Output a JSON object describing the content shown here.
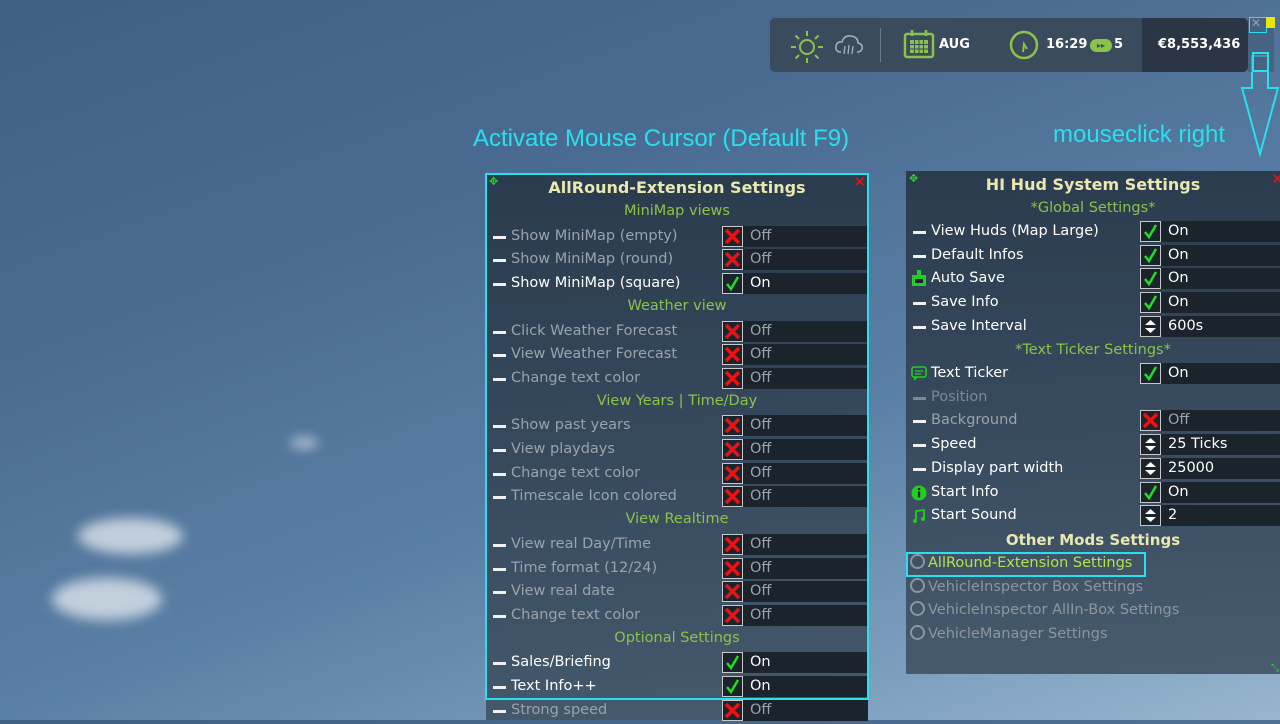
{
  "annotations": {
    "activate_cursor": "Activate Mouse Cursor (Default F9)",
    "mouseclick_right": "mouseclick right"
  },
  "hud": {
    "weather_icons": [
      "sun-icon",
      "cloud-rain-icon"
    ],
    "month": "AUG",
    "time": "16:29",
    "timescale": "5",
    "money": "€8,553,436"
  },
  "colors": {
    "accent_cyan": "#29e0ee",
    "section_green": "#8bc34a",
    "title_yellow": "#e8e8b0",
    "check_green": "#22dd22",
    "cross_red": "#ee1111"
  },
  "allround_panel": {
    "title": "AllRound-Extension Settings",
    "sections": [
      {
        "title": "MiniMap views",
        "rows": [
          {
            "label": "Show MiniMap (empty)",
            "state": "off",
            "value": "Off"
          },
          {
            "label": "Show MiniMap (round)",
            "state": "off",
            "value": "Off"
          },
          {
            "label": "Show MiniMap (square)",
            "state": "on",
            "value": "On"
          }
        ]
      },
      {
        "title": "Weather view",
        "rows": [
          {
            "label": "Click Weather Forecast",
            "state": "off",
            "value": "Off"
          },
          {
            "label": "View Weather Forecast",
            "state": "off",
            "value": "Off"
          },
          {
            "label": "Change text color",
            "state": "off",
            "value": "Off"
          }
        ]
      },
      {
        "title": "View Years | Time/Day",
        "rows": [
          {
            "label": "Show past years",
            "state": "off",
            "value": "Off"
          },
          {
            "label": "View playdays",
            "state": "off",
            "value": "Off"
          },
          {
            "label": "Change text color",
            "state": "off",
            "value": "Off"
          },
          {
            "label": "Timescale Icon colored",
            "state": "off",
            "value": "Off"
          }
        ]
      },
      {
        "title": "View Realtime",
        "rows": [
          {
            "label": "View real Day/Time",
            "state": "off",
            "value": "Off"
          },
          {
            "label": "Time format (12/24)",
            "state": "off",
            "value": "Off"
          },
          {
            "label": "View real date",
            "state": "off",
            "value": "Off"
          },
          {
            "label": "Change text color",
            "state": "off",
            "value": "Off"
          }
        ]
      },
      {
        "title": "Optional Settings",
        "rows": [
          {
            "label": "Sales/Briefing",
            "state": "on",
            "value": "On"
          },
          {
            "label": "Text Info++",
            "state": "on",
            "value": "On"
          },
          {
            "label": "Strong speed",
            "state": "off",
            "value": "Off"
          }
        ]
      }
    ]
  },
  "hud_panel": {
    "title": "HI Hud System Settings",
    "global_title": "*Global Settings*",
    "global_rows": [
      {
        "label": "View Huds (Map Large)",
        "icon": "dash",
        "kind": "check",
        "state": "on",
        "value": "On"
      },
      {
        "label": "Default Infos",
        "icon": "dash",
        "kind": "check",
        "state": "on",
        "value": "On"
      },
      {
        "label": "Auto Save",
        "icon": "save-icon",
        "kind": "check",
        "state": "on",
        "value": "On"
      },
      {
        "label": "Save Info",
        "icon": "dash",
        "kind": "check",
        "state": "on",
        "value": "On"
      },
      {
        "label": "Save Interval",
        "icon": "dash",
        "kind": "stepper",
        "state": "on",
        "value": "600s"
      }
    ],
    "ticker_title": "*Text Ticker Settings*",
    "ticker_rows": [
      {
        "label": "Text Ticker",
        "icon": "chat-icon",
        "kind": "check",
        "state": "on",
        "value": "On"
      },
      {
        "label": "Position",
        "icon": "dash-dim",
        "kind": "none",
        "state": "dim",
        "value": ""
      },
      {
        "label": "Background",
        "icon": "dash",
        "kind": "check",
        "state": "off",
        "value": "Off"
      },
      {
        "label": "Speed",
        "icon": "dash",
        "kind": "stepper",
        "state": "on",
        "value": "25 Ticks"
      },
      {
        "label": "Display part width",
        "icon": "dash",
        "kind": "stepper",
        "state": "on",
        "value": "25000"
      },
      {
        "label": "Start Info",
        "icon": "info-icon",
        "kind": "check",
        "state": "on",
        "value": "On"
      },
      {
        "label": "Start Sound",
        "icon": "music-icon",
        "kind": "stepper",
        "state": "on",
        "value": "2"
      }
    ],
    "other_title": "Other Mods Settings",
    "other_mods": [
      {
        "label": "AllRound-Extension Settings",
        "active": true
      },
      {
        "label": "VehicleInspector Box Settings",
        "active": false
      },
      {
        "label": "VehicleInspector AllIn-Box Settings",
        "active": false
      },
      {
        "label": "VehicleManager Settings",
        "active": false
      }
    ]
  }
}
